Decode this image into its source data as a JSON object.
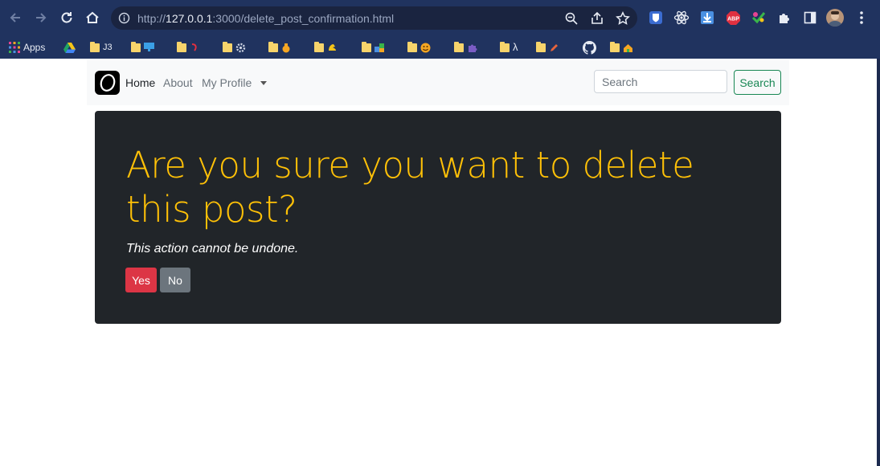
{
  "browser": {
    "url_prefix": "http://",
    "url_host": "127.0.0.1",
    "url_path": ":3000/delete_post_confirmation.html",
    "extensions": [
      "bitwarden-icon",
      "react-devtools-icon",
      "download-icon",
      "adblock-plus-icon",
      "color-picker-icon",
      "extensions-puzzle-icon",
      "sidebar-icon"
    ],
    "abp_label": "ABP"
  },
  "bookmarks": {
    "apps_label": "Apps",
    "items": [
      {
        "label": "J3"
      },
      {
        "label": ""
      },
      {
        "label": ""
      },
      {
        "label": ""
      },
      {
        "label": ""
      },
      {
        "label": ""
      },
      {
        "label": ""
      },
      {
        "label": ""
      },
      {
        "label": ""
      },
      {
        "label": "λ"
      },
      {
        "label": ""
      },
      {
        "label": ""
      }
    ]
  },
  "navbar": {
    "links": {
      "home": "Home",
      "about": "About",
      "profile": "My Profile"
    },
    "search_placeholder": "Search",
    "search_button": "Search"
  },
  "card": {
    "title": "Are you sure you want to delete this post?",
    "subtitle": "This action cannot be undone.",
    "yes_label": "Yes",
    "no_label": "No"
  },
  "colors": {
    "chrome": "#20335f",
    "card_bg": "#212529",
    "title": "#ffc107",
    "danger": "#dc3545",
    "secondary": "#6c757d",
    "success": "#198754"
  }
}
